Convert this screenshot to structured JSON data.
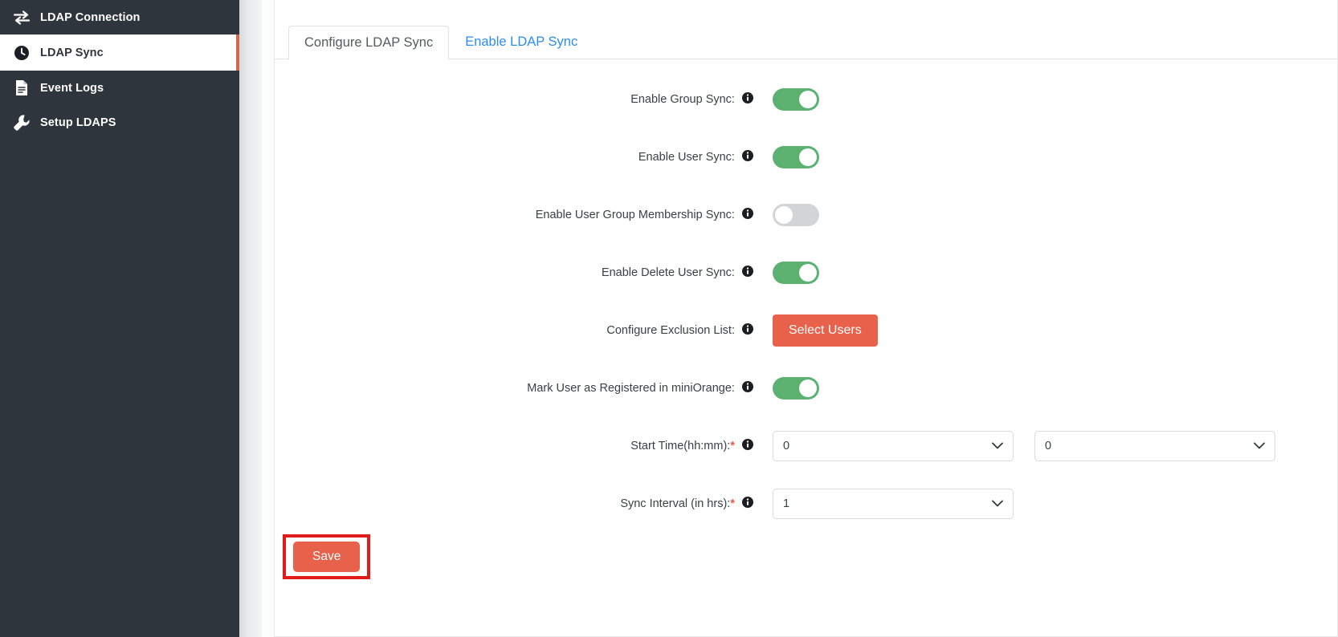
{
  "sidebar": {
    "items": [
      {
        "label": "LDAP Connection",
        "icon": "exchange-arrows-icon",
        "active": false
      },
      {
        "label": "LDAP Sync",
        "icon": "clock-icon",
        "active": true
      },
      {
        "label": "Event Logs",
        "icon": "document-icon",
        "active": false
      },
      {
        "label": "Setup LDAPS",
        "icon": "wrench-icon",
        "active": false
      }
    ]
  },
  "tabs": [
    {
      "label": "Configure LDAP Sync",
      "active": true
    },
    {
      "label": "Enable LDAP Sync",
      "active": false
    }
  ],
  "form": {
    "rows": [
      {
        "label": "Enable Group Sync:",
        "state": "on"
      },
      {
        "label": "Enable User Sync:",
        "state": "on"
      },
      {
        "label": "Enable User Group Membership Sync:",
        "state": "off"
      },
      {
        "label": "Enable Delete User Sync:",
        "state": "on"
      },
      {
        "label": "Configure Exclusion List:",
        "button": "Select Users"
      },
      {
        "label": "Mark User as Registered in miniOrange:",
        "state": "on"
      }
    ],
    "start_time": {
      "label": "Start Time(hh:mm):",
      "required": "*",
      "hours_value": "0",
      "minutes_value": "0"
    },
    "sync_interval": {
      "label": "Sync Interval (in hrs):",
      "required": "*",
      "value": "1"
    },
    "save_label": "Save"
  },
  "colors": {
    "sidebar_bg": "#2f353d",
    "accent_orange": "#e8614a",
    "toggle_on_green": "#5cb170",
    "toggle_off_gray": "#d3d4d5",
    "tab_link_blue": "#2d8cf0",
    "highlight_red": "#e01b1b",
    "required_red": "#e8594a"
  }
}
